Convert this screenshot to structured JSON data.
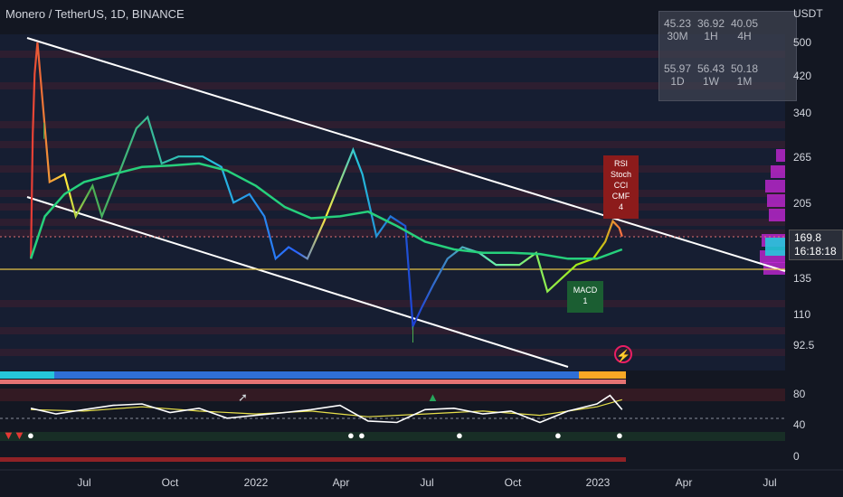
{
  "header": {
    "symbol_title": "Monero / TetherUS, 1D, BINANCE",
    "currency": "USDT"
  },
  "timeframe_table": [
    {
      "value": "45.23",
      "label": "30M"
    },
    {
      "value": "36.92",
      "label": "1H"
    },
    {
      "value": "40.05",
      "label": "4H"
    },
    {
      "value": "55.97",
      "label": "1D"
    },
    {
      "value": "56.43",
      "label": "1W"
    },
    {
      "value": "50.18",
      "label": "1M"
    }
  ],
  "price_readout": {
    "price": "169.8",
    "countdown": "16:18:18"
  },
  "badges": {
    "red": [
      "RSI",
      "Stoch",
      "CCI",
      "CMF",
      "4"
    ],
    "green": [
      "MACD",
      "1"
    ]
  },
  "colors": {
    "background": "#131722",
    "channel": "#ffffff",
    "support": "#e8c547",
    "ma": "#26d07c",
    "osc_main": "#ffffff",
    "osc_signal": "#e8e04a",
    "red_badge": "#8c1b1b",
    "green_badge": "#1b5e32"
  },
  "icons": [
    "bolt-icon",
    "panda-icon",
    "rocket-icon",
    "triangle-up-icon",
    "triangle-down-icon"
  ],
  "chart_data": [
    {
      "type": "line",
      "scale": "log",
      "x_ticks": [
        "Jul",
        "Oct",
        "2022",
        "Apr",
        "Jul",
        "Oct",
        "2023",
        "Apr",
        "Jul"
      ],
      "y_ticks": [
        500.0,
        420.0,
        340.0,
        265.0,
        205.0,
        135.0,
        110.0,
        92.5
      ],
      "ylim": [
        82,
        560
      ],
      "series": [
        {
          "points": [
            [
              "2021-05-05",
              150
            ],
            [
              "2021-05-07",
              300
            ],
            [
              "2021-05-09",
              420
            ],
            [
              "2021-05-12",
              500
            ],
            [
              "2021-05-19",
              330
            ],
            [
              "2021-05-25",
              230
            ],
            [
              "2021-06-10",
              240
            ],
            [
              "2021-06-22",
              190
            ],
            [
              "2021-07-10",
              225
            ],
            [
              "2021-07-20",
              190
            ],
            [
              "2021-08-10",
              250
            ],
            [
              "2021-08-26",
              310
            ],
            [
              "2021-09-07",
              330
            ],
            [
              "2021-09-22",
              255
            ],
            [
              "2021-10-10",
              265
            ],
            [
              "2021-11-05",
              265
            ],
            [
              "2021-11-25",
              250
            ],
            [
              "2021-12-08",
              205
            ],
            [
              "2021-12-25",
              215
            ],
            [
              "2022-01-10",
              190
            ],
            [
              "2022-01-22",
              150
            ],
            [
              "2022-02-05",
              160
            ],
            [
              "2022-02-25",
              150
            ],
            [
              "2022-03-15",
              185
            ],
            [
              "2022-04-01",
              230
            ],
            [
              "2022-04-15",
              275
            ],
            [
              "2022-04-25",
              240
            ],
            [
              "2022-05-10",
              170
            ],
            [
              "2022-05-25",
              190
            ],
            [
              "2022-06-10",
              180
            ],
            [
              "2022-06-18",
              103
            ],
            [
              "2022-06-28",
              115
            ],
            [
              "2022-07-10",
              130
            ],
            [
              "2022-07-25",
              150
            ],
            [
              "2022-08-10",
              160
            ],
            [
              "2022-08-28",
              155
            ],
            [
              "2022-09-15",
              145
            ],
            [
              "2022-10-10",
              145
            ],
            [
              "2022-10-28",
              155
            ],
            [
              "2022-11-09",
              125
            ],
            [
              "2022-11-25",
              135
            ],
            [
              "2022-12-10",
              145
            ],
            [
              "2022-12-28",
              150
            ],
            [
              "2023-01-10",
              165
            ],
            [
              "2023-01-18",
              185
            ],
            [
              "2023-01-25",
              178
            ],
            [
              "2023-01-28",
              169.8
            ]
          ]
        },
        {
          "points": [
            [
              "2021-05-05",
              150
            ],
            [
              "2021-05-20",
              190
            ],
            [
              "2021-06-10",
              215
            ],
            [
              "2021-07-01",
              230
            ],
            [
              "2021-08-01",
              240
            ],
            [
              "2021-09-01",
              250
            ],
            [
              "2021-10-01",
              252
            ],
            [
              "2021-11-01",
              255
            ],
            [
              "2021-12-01",
              245
            ],
            [
              "2022-01-01",
              225
            ],
            [
              "2022-02-01",
              200
            ],
            [
              "2022-03-01",
              188
            ],
            [
              "2022-04-01",
              190
            ],
            [
              "2022-05-01",
              195
            ],
            [
              "2022-06-01",
              180
            ],
            [
              "2022-07-01",
              165
            ],
            [
              "2022-08-01",
              158
            ],
            [
              "2022-09-01",
              155
            ],
            [
              "2022-10-01",
              155
            ],
            [
              "2022-11-01",
              154
            ],
            [
              "2022-12-01",
              150
            ],
            [
              "2023-01-01",
              150
            ],
            [
              "2023-01-28",
              158
            ]
          ]
        }
      ]
    },
    {
      "type": "line",
      "y_ticks": [
        80.0,
        40.0,
        0.0
      ],
      "ylim": [
        -8,
        100
      ],
      "series": [
        {
          "points": [
            [
              "2021-05-05",
              60
            ],
            [
              "2021-06-01",
              52
            ],
            [
              "2021-07-01",
              58
            ],
            [
              "2021-08-01",
              64
            ],
            [
              "2021-09-01",
              66
            ],
            [
              "2021-10-01",
              54
            ],
            [
              "2021-11-01",
              60
            ],
            [
              "2021-12-01",
              46
            ],
            [
              "2022-01-01",
              50
            ],
            [
              "2022-02-01",
              54
            ],
            [
              "2022-03-01",
              58
            ],
            [
              "2022-04-01",
              64
            ],
            [
              "2022-05-01",
              42
            ],
            [
              "2022-06-01",
              40
            ],
            [
              "2022-07-01",
              58
            ],
            [
              "2022-08-01",
              60
            ],
            [
              "2022-09-01",
              52
            ],
            [
              "2022-10-01",
              56
            ],
            [
              "2022-11-01",
              40
            ],
            [
              "2022-12-01",
              56
            ],
            [
              "2023-01-01",
              66
            ],
            [
              "2023-01-15",
              78
            ],
            [
              "2023-01-28",
              58
            ]
          ]
        },
        {
          "points": [
            [
              "2021-05-05",
              58
            ],
            [
              "2021-07-01",
              56
            ],
            [
              "2021-09-01",
              62
            ],
            [
              "2021-11-01",
              56
            ],
            [
              "2022-01-01",
              52
            ],
            [
              "2022-03-01",
              56
            ],
            [
              "2022-05-01",
              48
            ],
            [
              "2022-07-01",
              52
            ],
            [
              "2022-09-01",
              56
            ],
            [
              "2022-11-01",
              50
            ],
            [
              "2023-01-01",
              62
            ],
            [
              "2023-01-28",
              72
            ]
          ]
        }
      ]
    }
  ]
}
